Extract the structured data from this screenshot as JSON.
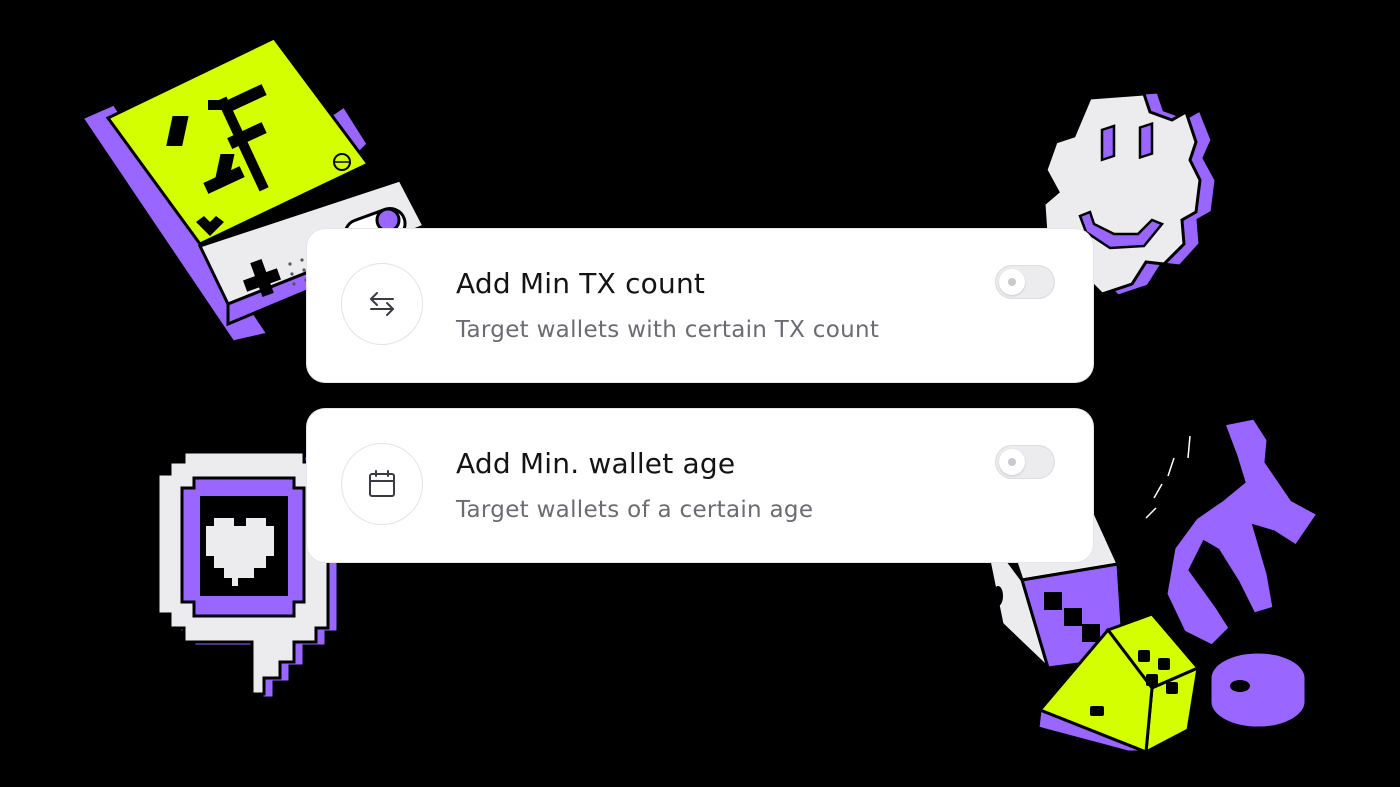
{
  "colors": {
    "background": "#000000",
    "card": "#ffffff",
    "accent_purple": "#9966ff",
    "accent_lime": "#d4ff00",
    "toggle_off": "#ececef"
  },
  "settings": [
    {
      "icon": "arrows-swap-icon",
      "title": "Add Min TX count",
      "description": "Target wallets with certain TX count",
      "enabled": false
    },
    {
      "icon": "calendar-icon",
      "title": "Add Min. wallet age",
      "description": "Target wallets of a certain age",
      "enabled": false
    }
  ],
  "decorations": [
    "handheld-console-dollar-illustration",
    "smiley-gear-illustration",
    "heart-speech-bubble-illustration",
    "dice-and-horseshoe-illustration"
  ]
}
